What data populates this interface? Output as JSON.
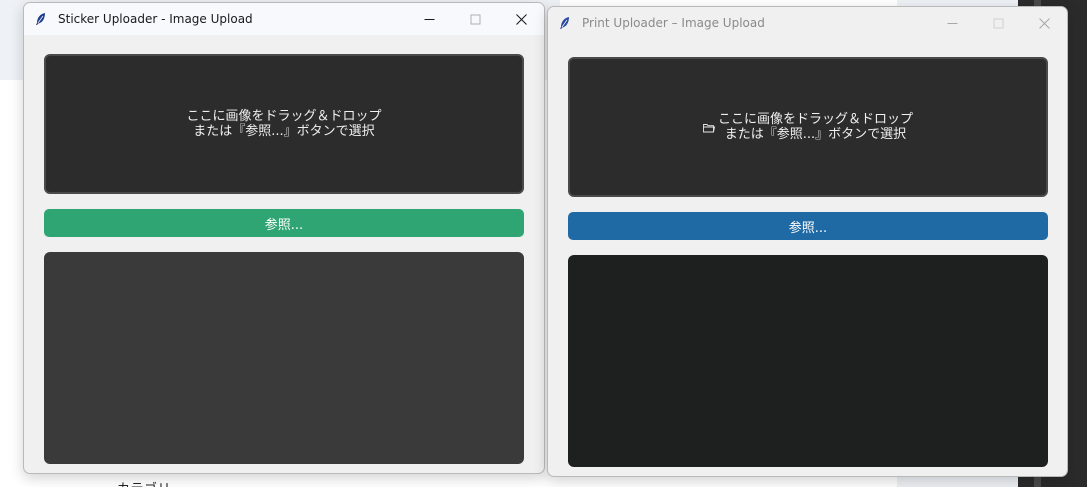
{
  "background": {
    "partial_text": "カテゴリ"
  },
  "sticker_window": {
    "title": "Sticker Uploader - Image Upload",
    "drop_zone": {
      "line1": "ここに画像をドラッグ＆ドロップ",
      "line2": "または『参照...』ボタンで選択"
    },
    "browse_label": "参照...",
    "browse_color": "#2ea572"
  },
  "print_window": {
    "title": "Print Uploader – Image Upload",
    "drop_zone": {
      "icon": "folder-icon",
      "line1": "ここに画像をドラッグ＆ドロップ",
      "line2": "または『参照...』ボタンで選択"
    },
    "browse_label": "参照...",
    "browse_color": "#1f6aa5"
  }
}
